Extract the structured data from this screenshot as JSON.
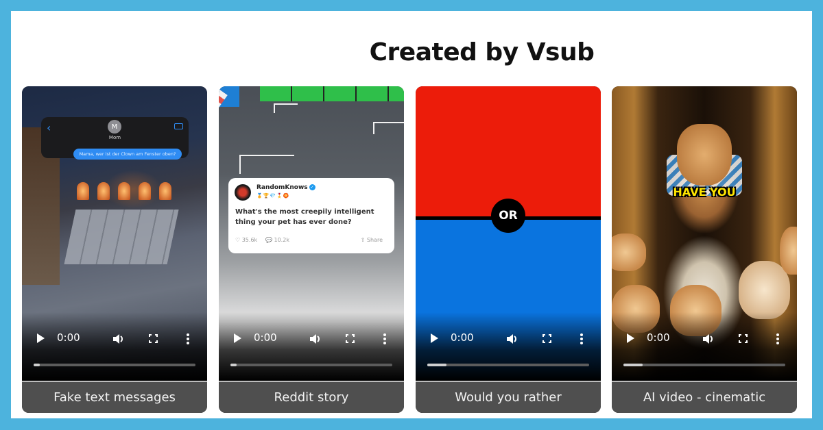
{
  "header": {
    "title": "Created by Vsub"
  },
  "colors": {
    "frame": "#4DB3DD",
    "label_bg": "#4f4f4f",
    "wyr_red": "#ec1c0a",
    "wyr_blue": "#0a74df",
    "caption_yellow": "#ffe600"
  },
  "cards": [
    {
      "label": "Fake text messages",
      "player": {
        "time": "0:00",
        "progress": 0.04
      },
      "chat": {
        "back_glyph": "‹",
        "avatar_initial": "M",
        "contact_name": "Mom",
        "message": "Mama, wer ist der Clown am Fenster oben?"
      }
    },
    {
      "label": "Reddit story",
      "player": {
        "time": "0:00",
        "progress": 0.04
      },
      "post": {
        "username": "RandomKnows",
        "verified_glyph": "✓",
        "badges": "🏅🏆💎🎖️🏵️",
        "text": "What's the most creepily intelligent thing your pet has ever done?",
        "likes": "♡ 35.6k",
        "comments": "💬 10.2k",
        "share": "⇪ Share"
      }
    },
    {
      "label": "Would you rather",
      "player": {
        "time": "0:00",
        "progress": 0.12
      },
      "or_text": "OR"
    },
    {
      "label": "AI video - cinematic",
      "player": {
        "time": "0:00",
        "progress": 0.12
      },
      "caption": "HAVE YOU"
    }
  ]
}
